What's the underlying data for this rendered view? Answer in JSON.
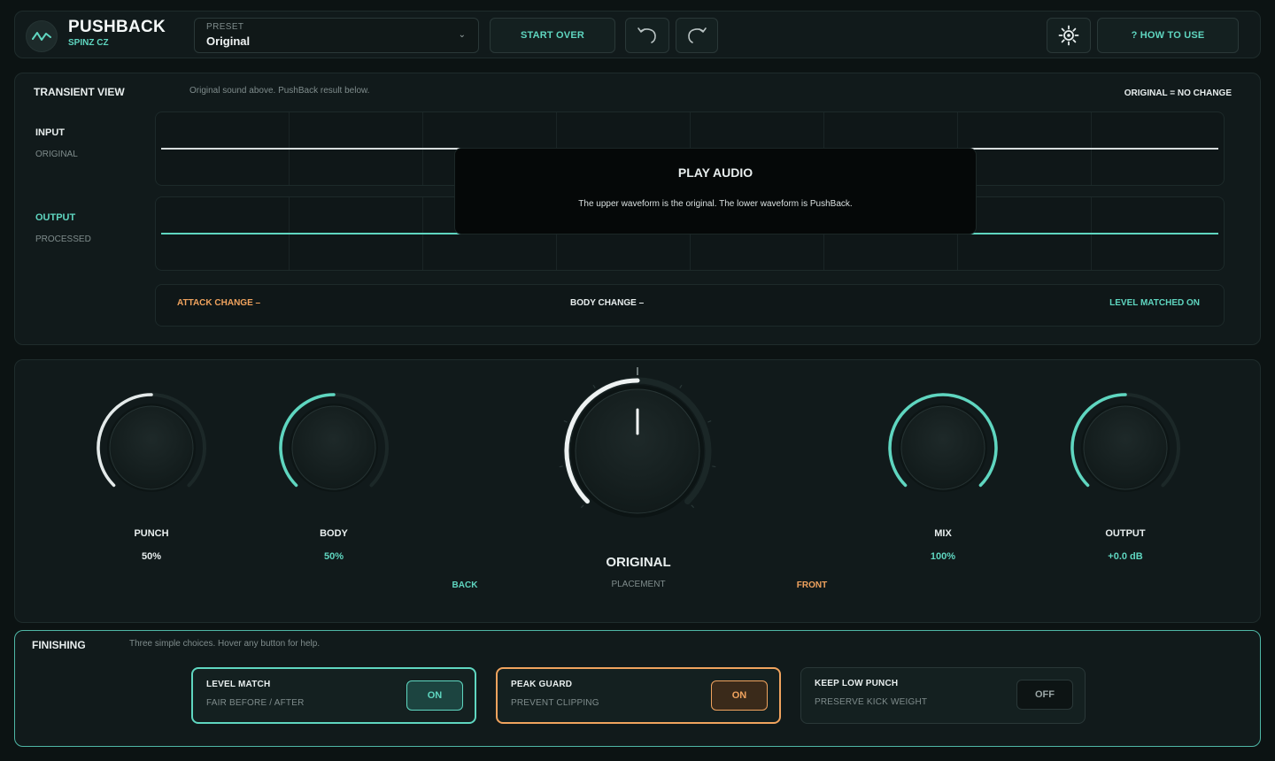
{
  "header": {
    "app_title": "PUSHBACK",
    "app_subtitle": "SPINZ CZ",
    "preset_label": "PRESET",
    "preset_value": "Original",
    "start_over_label": "START OVER",
    "help_label": "? HOW TO USE",
    "icons": [
      "waveform-logo-icon",
      "chevron-down-icon",
      "undo-icon",
      "redo-icon",
      "sun-icon"
    ]
  },
  "transient": {
    "title": "TRANSIENT VIEW",
    "description": "Original sound above. PushBack result below.",
    "status": "ORIGINAL = NO CHANGE",
    "input_label": "INPUT",
    "input_sub": "ORIGINAL",
    "output_label": "OUTPUT",
    "output_sub": "PROCESSED",
    "overlay_title": "PLAY AUDIO",
    "overlay_text": "The upper waveform is the original. The lower waveform is PushBack.",
    "attack_change": "ATTACK CHANGE –",
    "body_change": "BODY CHANGE –",
    "level_matched": "LEVEL MATCHED  ON",
    "colors": {
      "input_wave": "#d6dcdc",
      "output_wave": "#5fd6c0"
    }
  },
  "controls": {
    "punch": {
      "label": "PUNCH",
      "value": "50%",
      "level": 0.5
    },
    "body": {
      "label": "BODY",
      "value": "50%",
      "level": 0.5
    },
    "placement": {
      "value": "ORIGINAL",
      "label": "PLACEMENT",
      "left_label": "BACK",
      "right_label": "FRONT",
      "level": 0.5
    },
    "mix": {
      "label": "MIX",
      "value": "100%",
      "level": 1.0
    },
    "output": {
      "label": "OUTPUT",
      "value": "+0.0 dB",
      "level": 0.5
    }
  },
  "finishing": {
    "title": "FINISHING",
    "description": "Three simple choices. Hover any button for help.",
    "cards": [
      {
        "title": "LEVEL MATCH",
        "sub": "FAIR BEFORE / AFTER",
        "state": "ON",
        "accent": "#5fd6c0"
      },
      {
        "title": "PEAK GUARD",
        "sub": "PREVENT CLIPPING",
        "state": "ON",
        "accent": "#f0a35e"
      },
      {
        "title": "KEEP LOW PUNCH",
        "sub": "PRESERVE KICK WEIGHT",
        "state": "OFF",
        "accent": "#2a3838"
      }
    ]
  },
  "colors": {
    "accent": "#5fd6c0",
    "warm": "#f0a35e",
    "background": "#0c1313"
  }
}
